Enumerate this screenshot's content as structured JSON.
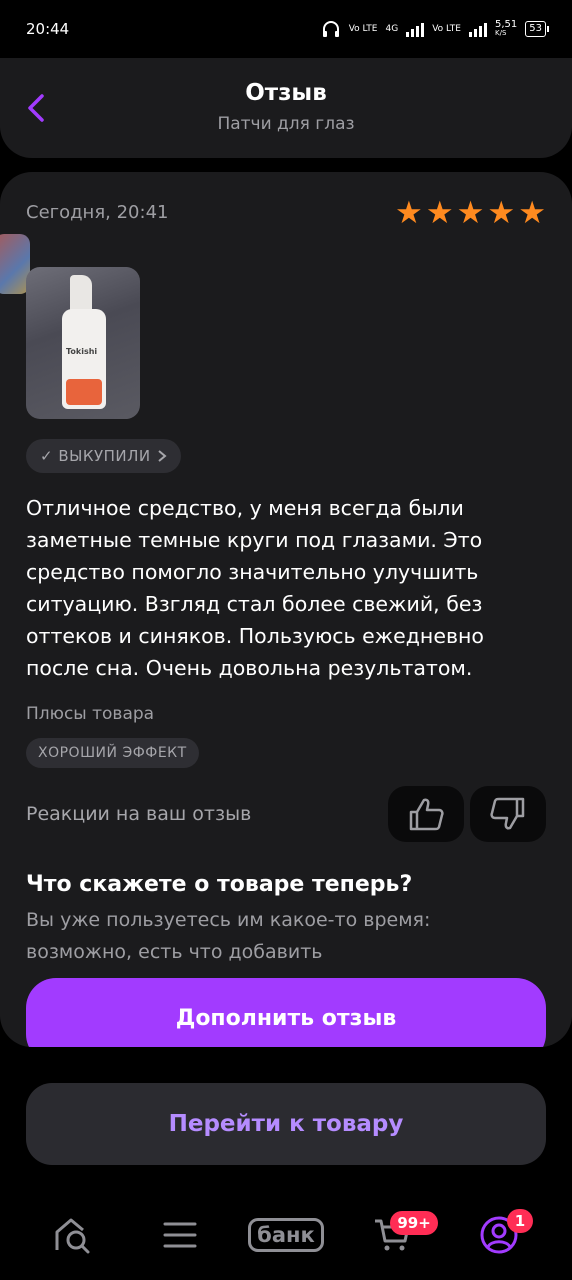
{
  "status_bar": {
    "time": "20:44",
    "net1": "Vo LTE",
    "net2": "4G",
    "net3": "Vo LTE",
    "speed": "5,51",
    "speed_unit": "K/S",
    "battery": "53"
  },
  "header": {
    "title": "Отзыв",
    "subtitle": "Патчи для глаз"
  },
  "review": {
    "date": "Сегодня, 20:41",
    "rating": 5,
    "photo_brand": "Tokishi",
    "bought_label": "✓ ВЫКУПИЛИ",
    "text": "Отличное средство, у меня всегда были заметные темные круги под глазами. Это средство помогло значительно улучшить ситуацию. Взгляд стал более свежий, без оттеков и синяков. Пользуюсь ежедневно после сна. Очень довольна результатом.",
    "pros_label": "Плюсы товара",
    "pros_tag": "ХОРОШИЙ ЭФФЕКТ",
    "reactions_label": "Реакции на ваш отзыв"
  },
  "prompt": {
    "title": "Что скажете о товаре теперь?",
    "description": "Вы уже пользуетесь им какое-то время: возможно, есть что добавить",
    "add_button": "Дополнить отзыв"
  },
  "goto_button": "Перейти к товару",
  "nav": {
    "bank_label": "банк",
    "cart_badge": "99+",
    "profile_badge": "1"
  },
  "colors": {
    "accent": "#a23bff",
    "star": "#ff8a1f",
    "badge": "#ff2d55"
  }
}
